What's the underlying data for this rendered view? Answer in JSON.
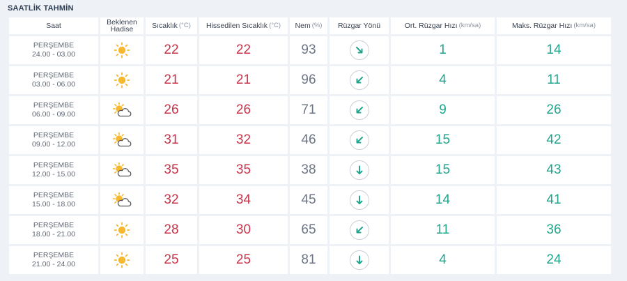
{
  "section_title": "SAATLİK TAHMİN",
  "headers": {
    "saat": "Saat",
    "hadise": "Beklenen Hadise",
    "sicaklik": "Sıcaklık",
    "sicaklik_unit": "(°C)",
    "hissedilen": "Hissedilen Sıcaklık",
    "hissedilen_unit": "(°C)",
    "nem": "Nem",
    "nem_unit": "(%)",
    "ruzgar_yonu": "Rüzgar Yönü",
    "ort_hiz": "Ort. Rüzgar Hızı",
    "ort_hiz_unit": "(km/sa)",
    "maks_hiz": "Maks. Rüzgar Hızı",
    "maks_hiz_unit": "(km/sa)"
  },
  "colors": {
    "temperature": "#c8344a",
    "humidity": "#6d7586",
    "wind": "#22a58c",
    "sun": "#f5b82e"
  },
  "rows": [
    {
      "day": "PERŞEMBE",
      "time": "24.00 - 03.00",
      "icon": "sunny-icon",
      "temp": "22",
      "feels": "22",
      "humidity": "93",
      "wind_dir": "north-west",
      "wind_icon": "arrow-down-right-icon",
      "avg": "1",
      "max": "14"
    },
    {
      "day": "PERŞEMBE",
      "time": "03.00 - 06.00",
      "icon": "sunny-icon",
      "temp": "21",
      "feels": "21",
      "humidity": "96",
      "wind_dir": "north-east",
      "wind_icon": "arrow-down-left-icon",
      "avg": "4",
      "max": "11"
    },
    {
      "day": "PERŞEMBE",
      "time": "06.00 - 09.00",
      "icon": "partly-cloudy-icon",
      "temp": "26",
      "feels": "26",
      "humidity": "71",
      "wind_dir": "north-north-east",
      "wind_icon": "arrow-down-left-icon",
      "avg": "9",
      "max": "26"
    },
    {
      "day": "PERŞEMBE",
      "time": "09.00 - 12.00",
      "icon": "partly-cloudy-icon",
      "temp": "31",
      "feels": "32",
      "humidity": "46",
      "wind_dir": "north-north-east",
      "wind_icon": "arrow-down-left-icon",
      "avg": "15",
      "max": "42"
    },
    {
      "day": "PERŞEMBE",
      "time": "12.00 - 15.00",
      "icon": "partly-cloudy-icon",
      "temp": "35",
      "feels": "35",
      "humidity": "38",
      "wind_dir": "north",
      "wind_icon": "arrow-down-icon",
      "avg": "15",
      "max": "43"
    },
    {
      "day": "PERŞEMBE",
      "time": "15.00 - 18.00",
      "icon": "partly-cloudy-icon",
      "temp": "32",
      "feels": "34",
      "humidity": "45",
      "wind_dir": "north",
      "wind_icon": "arrow-down-icon",
      "avg": "14",
      "max": "41"
    },
    {
      "day": "PERŞEMBE",
      "time": "18.00 - 21.00",
      "icon": "sunny-icon",
      "temp": "28",
      "feels": "30",
      "humidity": "65",
      "wind_dir": "north-north-east",
      "wind_icon": "arrow-down-left-icon",
      "avg": "11",
      "max": "36"
    },
    {
      "day": "PERŞEMBE",
      "time": "21.00 - 24.00",
      "icon": "sunny-icon",
      "temp": "25",
      "feels": "25",
      "humidity": "81",
      "wind_dir": "north",
      "wind_icon": "arrow-down-icon",
      "avg": "4",
      "max": "24"
    }
  ]
}
